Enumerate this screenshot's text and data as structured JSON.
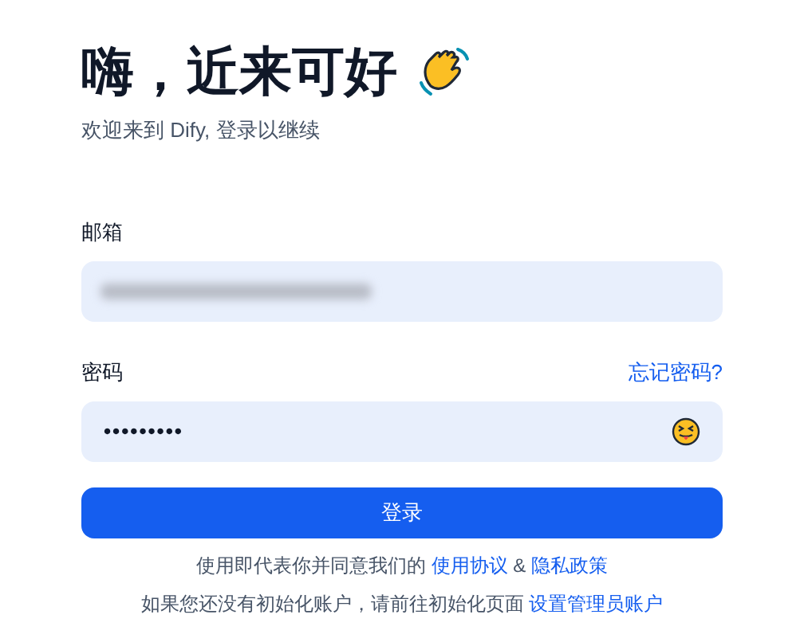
{
  "heading": "嗨，近来可好",
  "subtitle": "欢迎来到 Dify, 登录以继续",
  "email": {
    "label": "邮箱",
    "redacted": true
  },
  "password": {
    "label": "密码",
    "forgot_link": "忘记密码?",
    "value": "•••••••••"
  },
  "login_button": "登录",
  "terms": {
    "text": "使用即代表你并同意我们的",
    "terms_link": "使用协议",
    "joiner": "&",
    "privacy_link": "隐私政策"
  },
  "setup": {
    "text": "如果您还没有初始化账户，请前往初始化页面",
    "link": "设置管理员账户"
  }
}
